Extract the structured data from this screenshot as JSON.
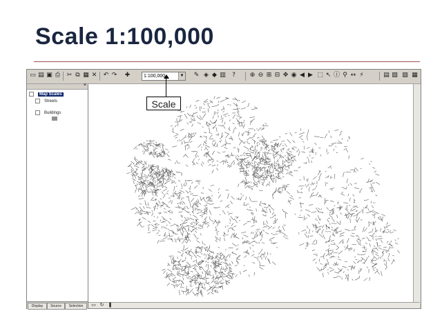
{
  "slide": {
    "title": "Scale 1:100,000"
  },
  "toolbar": {
    "scale_value": "1:100,000"
  },
  "toc": {
    "frame_label": "Map Scales",
    "layers": [
      "Streets",
      "Buildings"
    ],
    "tabs": [
      "Display",
      "Source",
      "Selection"
    ]
  },
  "callout": {
    "label": "Scale"
  },
  "colors": {
    "title": "#1a2640",
    "rule": "#a05050",
    "app_chrome": "#d4d0c8",
    "map_lines": "#5a5a5a",
    "selection": "#0a246a"
  }
}
